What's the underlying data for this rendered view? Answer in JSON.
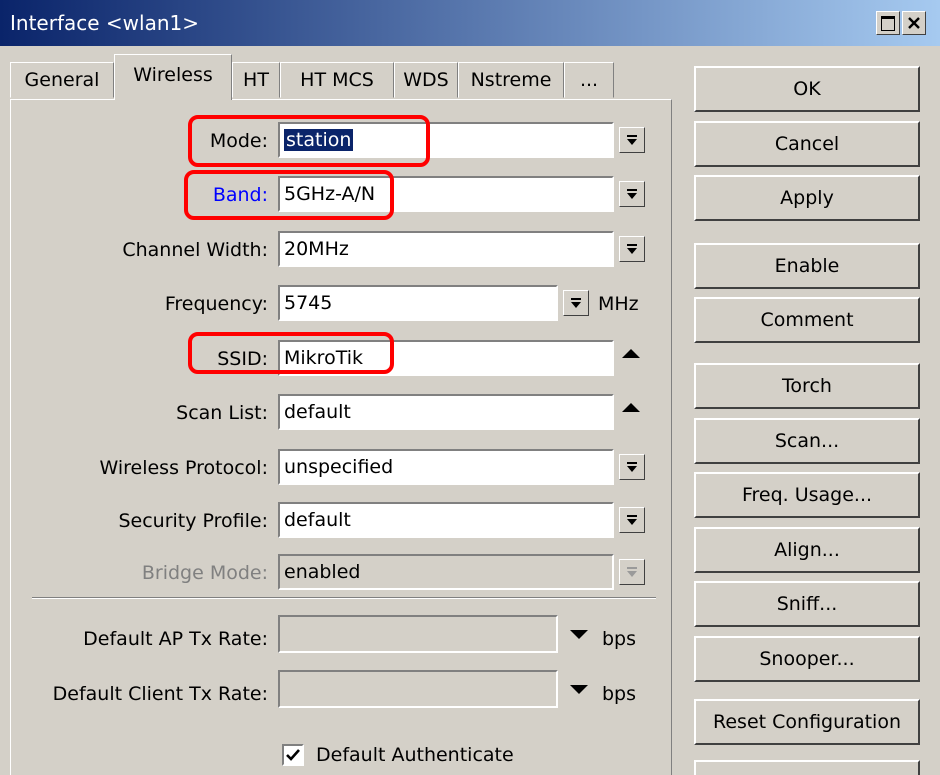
{
  "window": {
    "title": "Interface <wlan1>",
    "maximize_icon": "maximize-icon",
    "close_icon": "close-icon"
  },
  "tabs": [
    {
      "label": "General",
      "active": false
    },
    {
      "label": "Wireless",
      "active": true
    },
    {
      "label": "HT",
      "active": false
    },
    {
      "label": "HT MCS",
      "active": false
    },
    {
      "label": "WDS",
      "active": false
    },
    {
      "label": "Nstreme",
      "active": false
    },
    {
      "label": "...",
      "active": false
    }
  ],
  "form": {
    "mode": {
      "label": "Mode:",
      "value": "station"
    },
    "band": {
      "label": "Band:",
      "value": "5GHz-A/N"
    },
    "channel_width": {
      "label": "Channel Width:",
      "value": "20MHz"
    },
    "frequency": {
      "label": "Frequency:",
      "value": "5745",
      "unit": "MHz"
    },
    "ssid": {
      "label": "SSID:",
      "value": "MikroTik"
    },
    "scan_list": {
      "label": "Scan List:",
      "value": "default"
    },
    "wireless_protocol": {
      "label": "Wireless Protocol:",
      "value": "unspecified"
    },
    "security_profile": {
      "label": "Security Profile:",
      "value": "default"
    },
    "bridge_mode": {
      "label": "Bridge Mode:",
      "value": "enabled",
      "disabled": true
    },
    "default_ap_tx_rate": {
      "label": "Default AP Tx Rate:",
      "value": "",
      "unit": "bps"
    },
    "default_client_tx_rate": {
      "label": "Default Client Tx Rate:",
      "value": "",
      "unit": "bps"
    },
    "default_authenticate": {
      "label": "Default Authenticate",
      "checked": true
    }
  },
  "buttons": {
    "ok": "OK",
    "cancel": "Cancel",
    "apply": "Apply",
    "enable": "Enable",
    "comment": "Comment",
    "torch": "Torch",
    "scan": "Scan...",
    "freq_usage": "Freq. Usage...",
    "align": "Align...",
    "sniff": "Sniff...",
    "snooper": "Snooper...",
    "reset_configuration": "Reset Configuration"
  },
  "colors": {
    "titlebar_start": "#0a246a",
    "titlebar_end": "#a6caf0",
    "highlight": "#ff0000",
    "band_label": "#0000ff",
    "selection": "#0a246a"
  }
}
